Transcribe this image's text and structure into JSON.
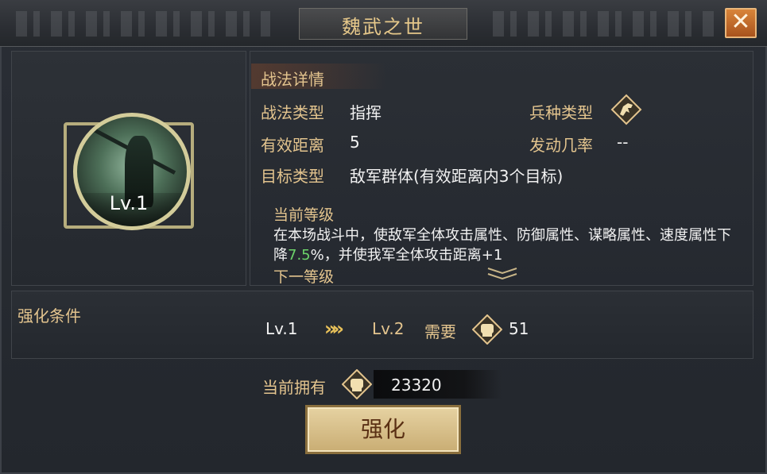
{
  "window": {
    "title": "魏武之世",
    "close_glyph": "✕"
  },
  "skill_icon": {
    "level_label": "Lv.1"
  },
  "details": {
    "header": "战法详情",
    "type_label": "战法类型",
    "type_value": "指挥",
    "troop_label": "兵种类型",
    "troop_icon": "cavalry-horse-icon",
    "range_label": "有效距离",
    "range_value": "5",
    "chance_label": "发动几率",
    "chance_value": "--",
    "target_label": "目标类型",
    "target_value": "敌军群体(有效距离内3个目标)",
    "current_level_label": "当前等级",
    "desc_part1": "在本场战斗中，使敌军全体攻击属性、防御属性、谋略属性、速度属性下降",
    "desc_highlight": "7.5",
    "desc_part2": "%，并使我军全体攻击距离+1",
    "next_level_label": "下一等级"
  },
  "enhance": {
    "conditions_label": "强化条件",
    "from_level": "Lv.1",
    "arrows": "»»",
    "to_level": "Lv.2",
    "need_label": "需要",
    "need_amount": "51"
  },
  "owned": {
    "label": "当前拥有",
    "amount": "23320"
  },
  "button": {
    "label": "强化"
  },
  "colors": {
    "gold_label": "#e3c48e",
    "highlight_green": "#6cd46a",
    "close_orange": "#c86a2a"
  }
}
